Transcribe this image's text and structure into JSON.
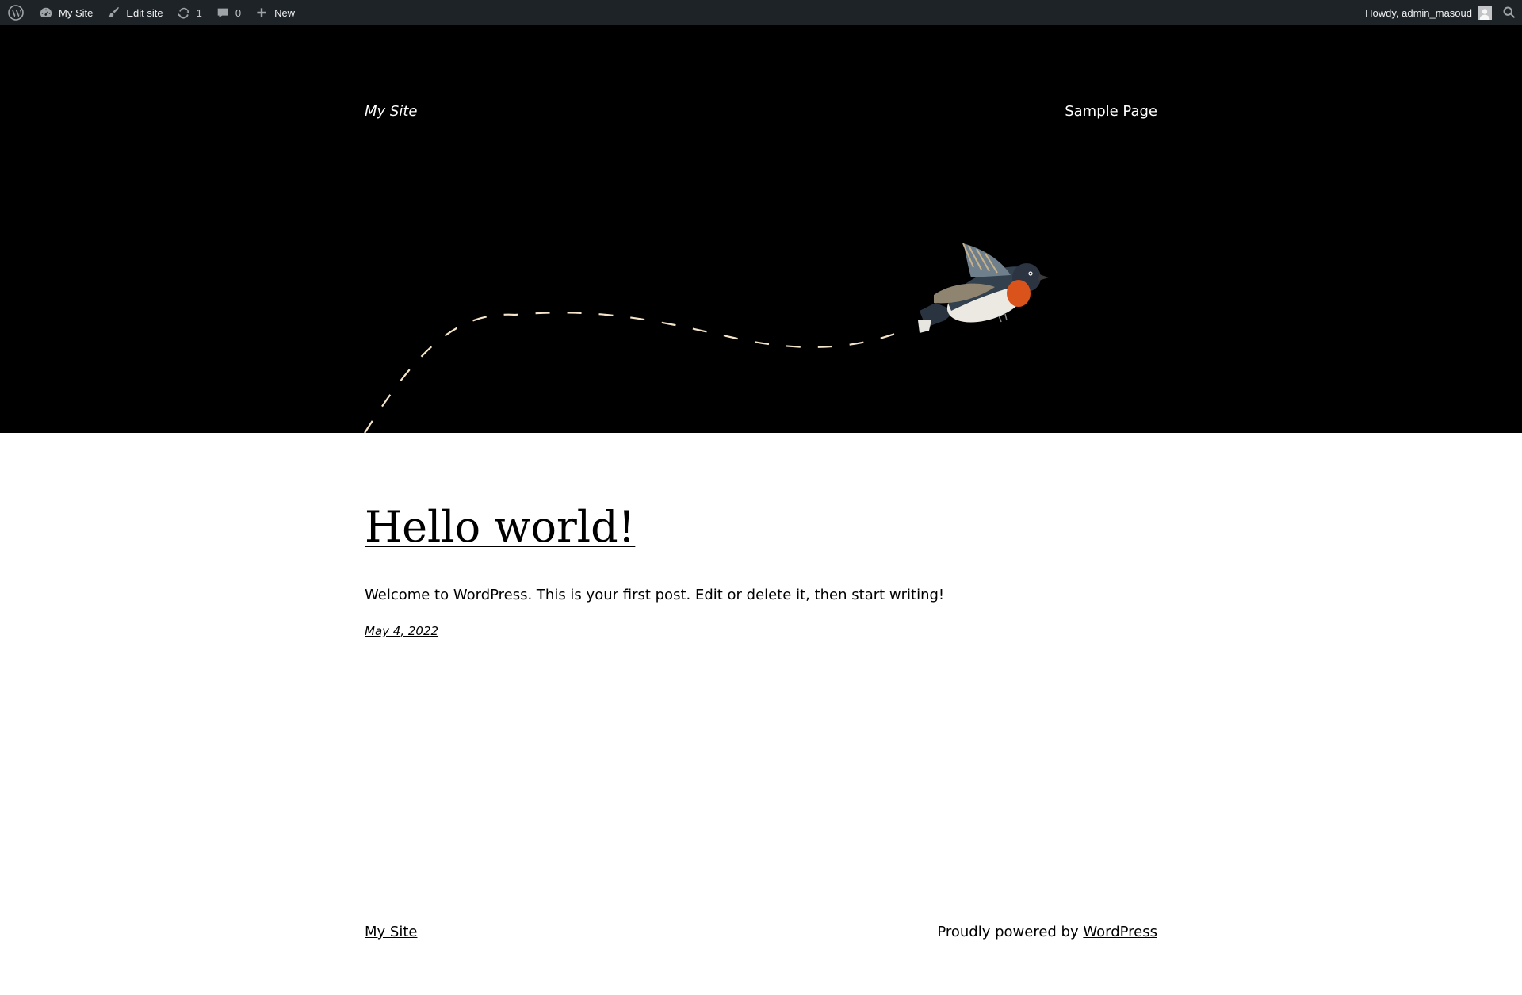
{
  "adminbar": {
    "wp_logo_icon": "wordpress-logo-icon",
    "site_name": "My Site",
    "edit_site": "Edit site",
    "updates_count": "1",
    "comments_count": "0",
    "new_label": "New",
    "howdy": "Howdy, admin_masoud",
    "colors": {
      "bar_bg": "#1d2327",
      "text": "#f0f0f1",
      "icon": "#9ea3a8"
    }
  },
  "header": {
    "site_title": "My Site",
    "nav": [
      {
        "label": "Sample Page"
      }
    ],
    "background": "#000000",
    "illustration": "bird-with-dashed-flight-path"
  },
  "post": {
    "title": "Hello world!",
    "excerpt": "Welcome to WordPress. This is your first post. Edit or delete it, then start writing!",
    "date": "May 4, 2022"
  },
  "footer": {
    "site_title": "My Site",
    "credit_prefix": "Proudly powered by ",
    "credit_link": "WordPress"
  }
}
